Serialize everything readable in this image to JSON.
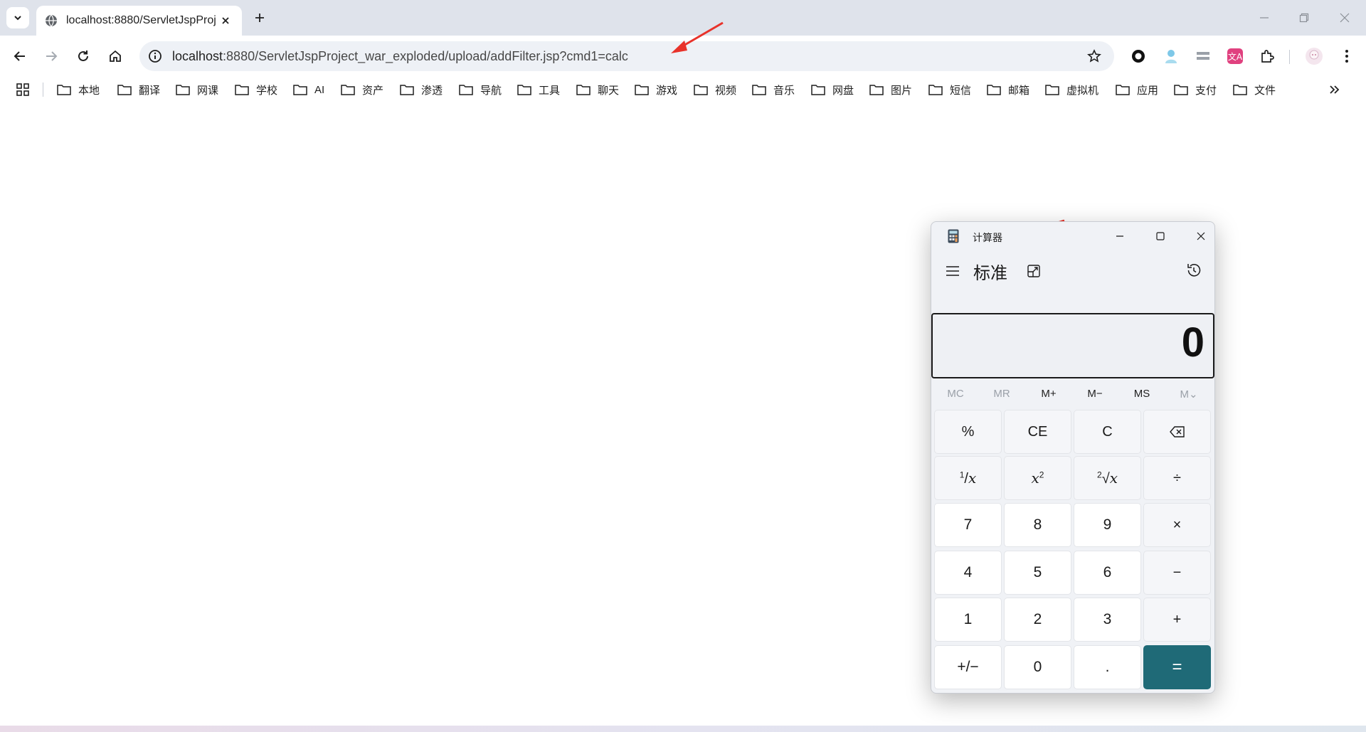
{
  "browser": {
    "tab": {
      "title": "localhost:8880/ServletJspProj",
      "icon": "globe-icon"
    },
    "address": {
      "host": "localhost",
      "path": ":8880/ServletJspProject_war_exploded/upload/addFilter.jsp?cmd1=calc"
    },
    "bookmarks": [
      "本地",
      "翻译",
      "网课",
      "学校",
      "AI",
      "资产",
      "渗透",
      "导航",
      "工具",
      "聊天",
      "游戏",
      "视频",
      "音乐",
      "网盘",
      "图片",
      "短信",
      "邮箱",
      "虚拟机",
      "应用",
      "支付",
      "文件"
    ]
  },
  "calculator": {
    "window_title": "计算器",
    "mode": "标准",
    "display": "0",
    "memory": [
      "MC",
      "MR",
      "M+",
      "M−",
      "MS",
      "M⌄"
    ],
    "keys": {
      "percent": "%",
      "ce": "CE",
      "c": "C",
      "divide": "÷",
      "multiply": "×",
      "minus": "−",
      "plus": "+",
      "seven": "7",
      "eight": "8",
      "nine": "9",
      "four": "4",
      "five": "5",
      "six": "6",
      "one": "1",
      "two": "2",
      "three": "3",
      "negate": "+/−",
      "zero": "0",
      "decimal": ".",
      "equals": "="
    }
  },
  "colors": {
    "equals_key": "#1f6a77",
    "annotation_arrow": "#e8322a",
    "tabstrip": "#dfe3eb"
  }
}
